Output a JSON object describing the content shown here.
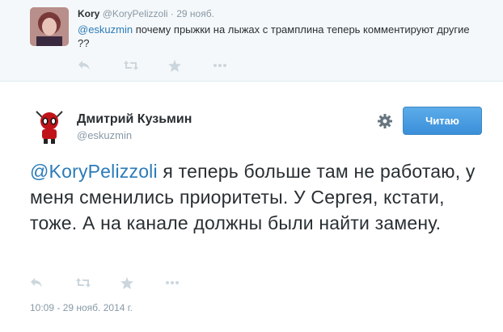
{
  "reply": {
    "name": "Kory",
    "handle": "@KoryPelizzoli",
    "separator": "·",
    "time": "29 нояб.",
    "mention": "@eskuzmin",
    "text": " почему прыжки на лыжах с трамплина теперь комментируют другие ??"
  },
  "tweet": {
    "name": "Дмитрий Кузьмин",
    "handle": "@eskuzmin",
    "follow_label": "Читаю",
    "mention": "@KoryPelizzoli",
    "text": " я теперь больше там не работаю, у меня сменились приоритеты. У Сергея, кстати, тоже. А на канале должны были найти замену.",
    "timestamp": "10:09 - 29 нояб. 2014 г."
  },
  "icons": {
    "reply": "reply-icon",
    "retweet": "retweet-icon",
    "favorite": "star-icon",
    "more": "more-icon",
    "settings": "gear-icon"
  },
  "colors": {
    "link": "#2b7bb9",
    "button": "#4a9de2",
    "muted": "#8899a6",
    "icon": "#ccd6dd"
  }
}
